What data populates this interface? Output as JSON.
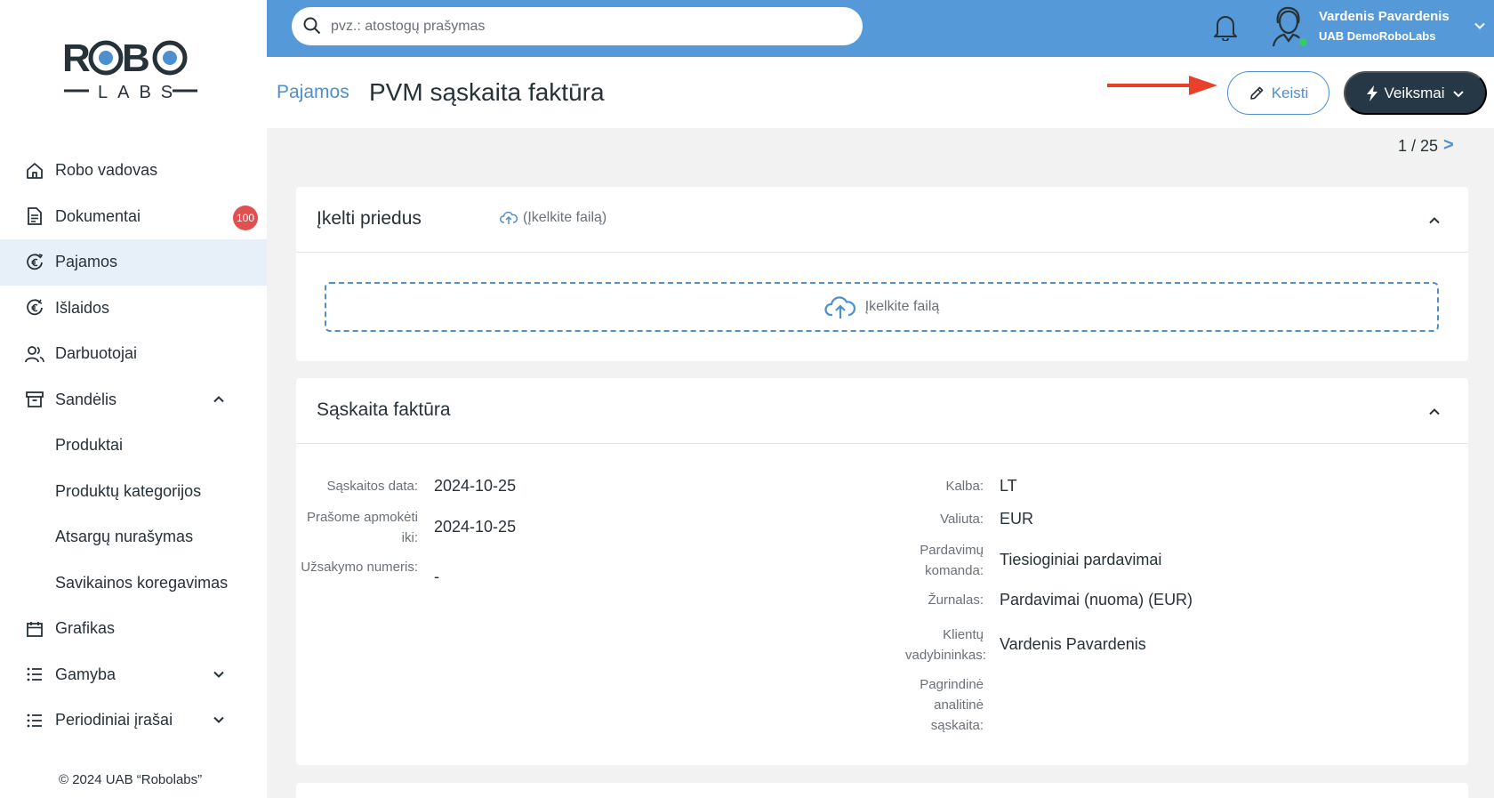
{
  "brand": {
    "logo_top": "ROBO",
    "logo_bottom": "LABS"
  },
  "search": {
    "placeholder": "pvz.: atostogų prašymas"
  },
  "user": {
    "name": "Vardenis Pavardenis",
    "company": "UAB DemoRoboLabs"
  },
  "sidebar": {
    "items": [
      {
        "label": "Robo vadovas",
        "icon": "home-icon"
      },
      {
        "label": "Dokumentai",
        "icon": "document-icon",
        "badge": "100"
      },
      {
        "label": "Pajamos",
        "icon": "euro-income-icon",
        "active": true
      },
      {
        "label": "Išlaidos",
        "icon": "euro-expense-icon"
      },
      {
        "label": "Darbuotojai",
        "icon": "users-icon"
      },
      {
        "label": "Sandėlis",
        "icon": "archive-icon",
        "expanded": true
      },
      {
        "label": "Produktai"
      },
      {
        "label": "Produktų kategorijos"
      },
      {
        "label": "Atsargų nurašymas"
      },
      {
        "label": "Savikainos koregavimas"
      },
      {
        "label": "Grafikas",
        "icon": "calendar-icon"
      },
      {
        "label": "Gamyba",
        "icon": "list-icon",
        "expanded": false
      },
      {
        "label": "Periodiniai įrašai",
        "icon": "list-icon",
        "expanded": false
      }
    ],
    "copyright": "© 2024 UAB “Robolabs”"
  },
  "header": {
    "breadcrumb": "Pajamos",
    "title": "PVM sąskaita faktūra",
    "edit_label": "Keisti",
    "actions_label": "Veiksmai"
  },
  "pager": {
    "text": "1 / 25",
    "next": ">"
  },
  "attachments": {
    "title": "Įkelti priedus",
    "upload_link": "(Įkelkite failą)",
    "dropzone_label": "Įkelkite failą"
  },
  "invoice": {
    "title": "Sąskaita faktūra",
    "left": [
      {
        "label": "Sąskaitos data:",
        "value": "2024-10-25"
      },
      {
        "label": "Prašome apmokėti iki:",
        "value": "2024-10-25"
      },
      {
        "label": "Užsakymo numeris:",
        "value": "-"
      }
    ],
    "right": [
      {
        "label": "Kalba:",
        "value": "LT"
      },
      {
        "label": "Valiuta:",
        "value": "EUR"
      },
      {
        "label": "Pardavimų komanda:",
        "value": "Tiesioginiai pardavimai"
      },
      {
        "label": "Žurnalas:",
        "value": "Pardavimai (nuoma) (EUR)"
      },
      {
        "label": "Klientų vadybininkas:",
        "value": "Vardenis Pavardenis"
      },
      {
        "label": "Pagrindinė analitinė sąskaita:",
        "value": ""
      }
    ]
  },
  "colors": {
    "accent": "#5599d8",
    "link": "#4d8fcf",
    "dark": "#263746",
    "badge": "#e05050",
    "arrow": "#e8402a"
  }
}
